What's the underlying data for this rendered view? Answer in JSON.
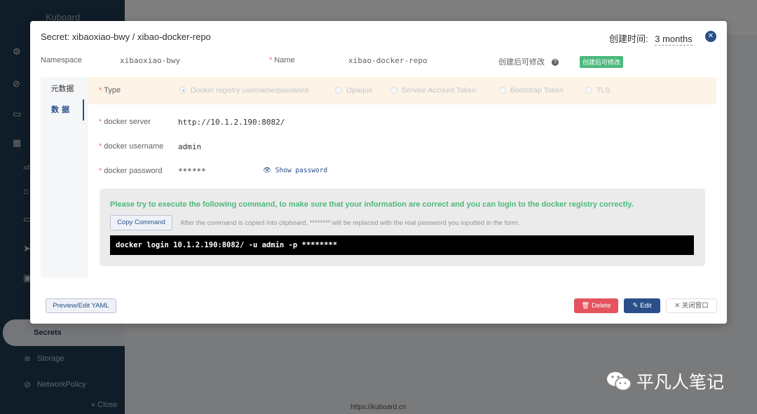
{
  "app": {
    "brand": "Kuboard",
    "sidebar_namespace": "xib",
    "sidebar_items": [
      {
        "label": "Secrets",
        "icon": "key-icon"
      },
      {
        "label": "Storage",
        "icon": "storage-icon"
      },
      {
        "label": "NetworkPolicy",
        "icon": "network-policy-icon"
      }
    ],
    "close_label": "« Close",
    "footer": "https://kuboard.cn"
  },
  "dialog": {
    "title": "Secret: xibaoxiao-bwy / xibao-docker-repo",
    "created_label": "创建时间:",
    "created_value": "3 months",
    "namespace_label": "Namespace",
    "namespace_value": "xibaoxiao-bwy",
    "name_label": "Name",
    "name_value": "xibao-docker-repo",
    "editable_label": "创建后可修改",
    "editable_tag": "创建后可修改",
    "tabs": [
      {
        "label": "元数据"
      },
      {
        "label": "数据"
      }
    ],
    "type_label": "Type",
    "type_options": [
      {
        "label": "Docker registry username/password",
        "checked": true
      },
      {
        "label": "Opaque",
        "checked": false
      },
      {
        "label": "Service Account Token",
        "checked": false
      },
      {
        "label": "Bootstrap Token",
        "checked": false
      },
      {
        "label": "TLS",
        "checked": false
      }
    ],
    "fields": {
      "server_label": "docker server",
      "server_value": "http://10.1.2.190:8082/",
      "username_label": "docker username",
      "username_value": "admin",
      "password_label": "docker password",
      "password_value": "******",
      "show_password": "Show password"
    },
    "command": {
      "tip": "Please try to execute the following command, to make sure that your information are correct and you can login to the docker registry correctly.",
      "copy_button": "Copy Command",
      "copy_note": "After the command is copied into clipboard, ******** will be replaced with the real password you inputted in the form.",
      "text": "docker login 10.1.2.190:8082/ -u admin -p ********"
    },
    "buttons": {
      "yaml": "Preview/Edit YAML",
      "delete": "Delete",
      "edit": "Edit",
      "close": "关闭窗口"
    }
  },
  "watermark": "平凡人笔记",
  "colors": {
    "primary": "#2a4f8a",
    "success": "#4cb97d",
    "danger": "#e5535e",
    "sidebar": "#1f3a52"
  }
}
